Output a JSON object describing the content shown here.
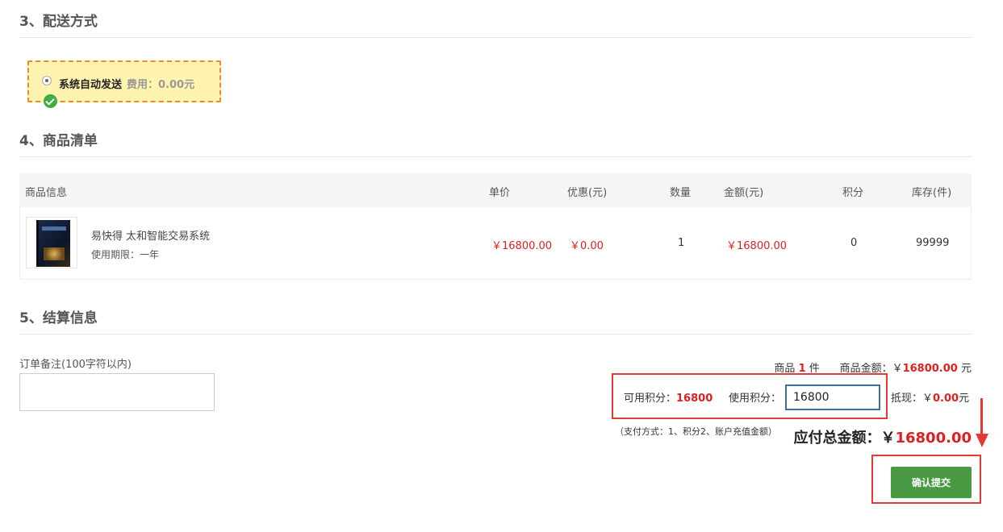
{
  "sections": {
    "delivery": "3、配送方式",
    "goods": "4、商品清单",
    "settlement": "5、结算信息"
  },
  "delivery": {
    "option_label": "系统自动发送",
    "fee_text": "费用：0.00元",
    "selected": true
  },
  "table": {
    "headers": {
      "info": "商品信息",
      "price": "单价",
      "discount": "优惠(元)",
      "qty": "数量",
      "amount": "金额(元)",
      "points": "积分",
      "stock": "库存(件)"
    },
    "rows": [
      {
        "name": "易快得 太和智能交易系统",
        "period": "使用期限：一年",
        "price": "￥16800.00",
        "discount": "￥0.00",
        "qty": "1",
        "amount": "￥16800.00",
        "points": "0",
        "stock": "99999"
      }
    ]
  },
  "remark": {
    "label": "订单备注(100字符以内)",
    "value": ""
  },
  "summary": {
    "goods_prefix": "商品",
    "goods_count": "1",
    "goods_suffix": "件",
    "amount_label": "商品金额：￥",
    "amount_value": "16800.00",
    "amount_unit": "元",
    "points_avail_label": "可用积分：",
    "points_avail_value": "16800",
    "points_use_label": "使用积分：",
    "points_use_value": "16800",
    "cash_label": "抵现：￥",
    "cash_value": "0.00",
    "cash_unit": "元",
    "pay_note": "（支付方式：1、积分2、账户充值金额）",
    "total_label": "应付总金额：￥",
    "total_value": "16800.00"
  },
  "submit_label": "确认提交",
  "colors": {
    "accent_red": "#e02020",
    "highlight_border": "#e53935",
    "submit_green": "#4a9a44",
    "delivery_bg": "#fff3b0",
    "delivery_border": "#f08a24"
  }
}
